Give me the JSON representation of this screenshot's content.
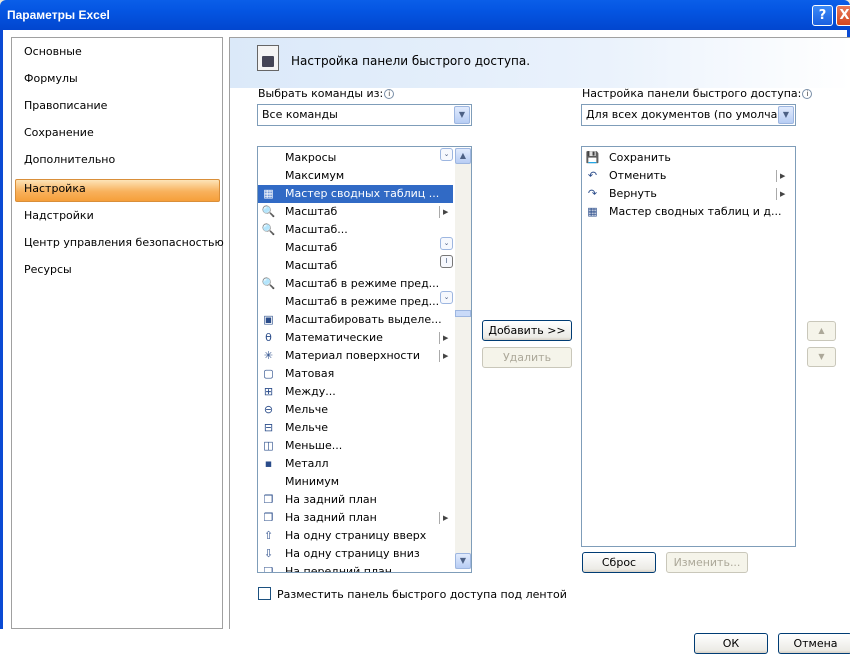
{
  "window": {
    "title": "Параметры Excel",
    "help_icon": "?",
    "close_icon": "X"
  },
  "nav": {
    "items": [
      "Основные",
      "Формулы",
      "Правописание",
      "Сохранение",
      "Дополнительно",
      "Настройка",
      "Надстройки",
      "Центр управления безопасностью",
      "Ресурсы"
    ],
    "selected": "Настройка"
  },
  "header": {
    "title": "Настройка панели быстрого доступа."
  },
  "left": {
    "label": "Выбрать команды из:",
    "combo_value": "Все команды"
  },
  "right": {
    "label": "Настройка панели быстрого доступа:",
    "combo_value": "Для всех документов (по умолча..."
  },
  "commands": [
    {
      "label": "Макросы",
      "icon": "",
      "arrow": false
    },
    {
      "label": "Максимум",
      "icon": "",
      "arrow": false
    },
    {
      "label": "Мастер сводных таблиц ...",
      "icon": "table",
      "arrow": false
    },
    {
      "label": "Масштаб",
      "icon": "zoom",
      "arrow": true
    },
    {
      "label": "Масштаб...",
      "icon": "zoom",
      "arrow": false
    },
    {
      "label": "Масштаб",
      "icon": "",
      "arrow": false
    },
    {
      "label": "Масштаб",
      "icon": "",
      "arrow": false
    },
    {
      "label": "Масштаб в режиме пред...",
      "icon": "zoom",
      "arrow": false
    },
    {
      "label": "Масштаб в режиме пред...",
      "icon": "",
      "arrow": false
    },
    {
      "label": "Масштабировать выделе...",
      "icon": "zoom-sel",
      "arrow": false
    },
    {
      "label": "Математические",
      "icon": "math",
      "arrow": true
    },
    {
      "label": "Материал поверхности",
      "icon": "material",
      "arrow": true
    },
    {
      "label": "Матовая",
      "icon": "matte",
      "arrow": false
    },
    {
      "label": "Между...",
      "icon": "between",
      "arrow": false
    },
    {
      "label": "Мельче",
      "icon": "zoom-out",
      "arrow": false
    },
    {
      "label": "Мельче",
      "icon": "smaller",
      "arrow": false
    },
    {
      "label": "Меньше...",
      "icon": "less",
      "arrow": false
    },
    {
      "label": "Металл",
      "icon": "metal",
      "arrow": false
    },
    {
      "label": "Минимум",
      "icon": "",
      "arrow": false
    },
    {
      "label": "На задний план",
      "icon": "back",
      "arrow": false
    },
    {
      "label": "На задний план",
      "icon": "back",
      "arrow": true
    },
    {
      "label": "На одну страницу вверх",
      "icon": "page-up",
      "arrow": false
    },
    {
      "label": "На одну страницу вниз",
      "icon": "page-down",
      "arrow": false
    },
    {
      "label": "На передний план",
      "icon": "front",
      "arrow": false
    }
  ],
  "selected_command": "Мастер сводных таблиц ...",
  "qat": [
    {
      "label": "Сохранить",
      "icon": "save",
      "arrow": false
    },
    {
      "label": "Отменить",
      "icon": "undo",
      "arrow": true
    },
    {
      "label": "Вернуть",
      "icon": "redo",
      "arrow": true
    },
    {
      "label": "Мастер сводных таблиц и д...",
      "icon": "table",
      "arrow": false
    }
  ],
  "buttons": {
    "add": "Добавить >>",
    "remove": "Удалить",
    "reset": "Сброс",
    "modify": "Изменить...",
    "ok": "ОК",
    "cancel": "Отмена"
  },
  "checkbox": {
    "label": "Разместить панель быстрого доступа под лентой",
    "checked": false
  }
}
